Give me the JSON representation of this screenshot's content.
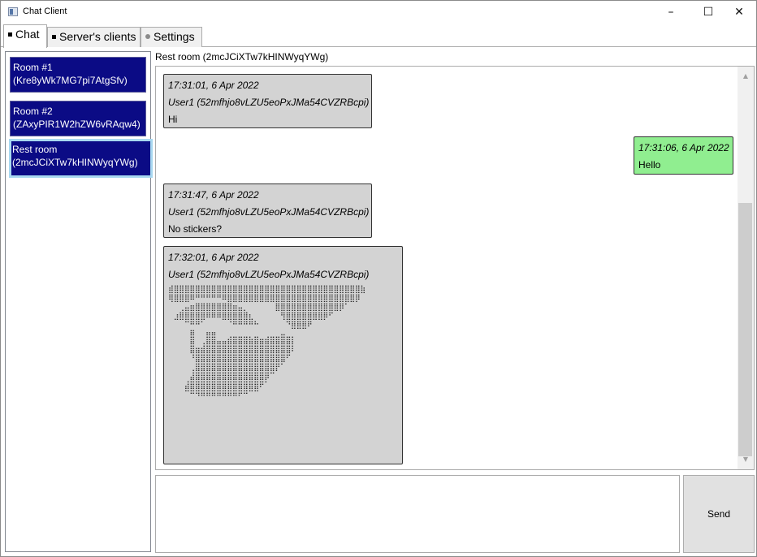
{
  "window": {
    "title": "Chat Client",
    "minimize": "–",
    "maximize": "☐",
    "close": "✕"
  },
  "tabs": [
    {
      "label": "Chat",
      "active": true
    },
    {
      "label": "Server's clients",
      "active": false
    },
    {
      "label": "Settings",
      "active": false
    }
  ],
  "rooms": [
    {
      "name": "Room #1",
      "id": "(Kre8yWk7MG7pi7AtgSfv)",
      "selected": false
    },
    {
      "name": "Room #2",
      "id": "(ZAxyPIR1W2hZW6vRAqw4)",
      "selected": false
    },
    {
      "name": "Rest room",
      "id": "(2mcJCiXTw7kHINWyqYWg)",
      "selected": true
    }
  ],
  "chat": {
    "header": "Rest room (2mcJCiXTw7kHINWyqYWg)",
    "messages": [
      {
        "time": "17:31:01, 6 Apr 2022",
        "user": "User1 (52mfhjo8vLZU5eoPxJMa54CVZRBcpi)",
        "text": "Hi",
        "mine": false
      },
      {
        "time": "17:31:06, 6 Apr 2022",
        "user": "",
        "text": "Hello",
        "mine": true
      },
      {
        "time": "17:31:47, 6 Apr 2022",
        "user": "User1 (52mfhjo8vLZU5eoPxJMa54CVZRBcpi)",
        "text": "No stickers?",
        "mine": false
      },
      {
        "time": "17:32:01, 6 Apr 2022",
        "user": "User1 (52mfhjo8vLZU5eoPxJMa54CVZRBcpi)",
        "text": "⣾⣿⣿⣿⣿⣿⣿⣿⣿⣿⣿⣿⣿⣿⣿⣿⣿⣿⣿⣿⣿⣿⣿⣿⣿⣿⣿⣿⣿⣿⣿⣿⣿⣿⣿⣿⣷\n⢿⣿⣿⣿⠿⠛⠛⠛⠛⠛⠿⣿⣿⣿⣿⣿⣿⣿⣿⣿⣿⣿⣿⣿⣿⣿⣿⣿⣿⣿⣿⣿⣿⣿⣿⡿\n⠀⠀⢀⣤⣶⣿⣿⣿⣿⣿⣿⣿⣶⣤⡀⠀⠀⠀⠀⠀⣿⣿⣿⣿⣿⣿⣿⣿⣿⣿⣿⣿⡿⠁\n⠀⣰⣿⣿⣿⣿⣿⠿⠿⠿⣿⣿⣿⣿⣿⣆⠀⠀⠀⠀⠀⢻⣿⣿⣿⣿⣿⣿⣿⡿⠋⠀\n⠀⠀⠀⠉⠛⠛⠁⠀⠀⠀⠀⠈⠛⠛⠛⠛⠓⠀⠀⠀⠀⠀⠙⣿⣿⣿⠟⠀⠀⠀\n⠀⠀⠀⠀⣿⠀⠀⣶⣶⠀⠀⢀⣀⣀⣀⡀⣀⠀⢀⣀⣀⣤⣀⡀⠀⠀⠀⠀\n⠀⠀⠀⠀⣿⠀⢠⣿⣿⣶⣶⣿⣿⣿⣿⣿⣿⣿⣿⣿⣿⣿⣿⡇⠀⠀⠀⠀\n⠀⠀⠀⠀⢿⣿⣿⣿⣿⣿⣿⣿⣿⣿⣿⣿⣿⣿⣿⣿⣿⣿⣿⠃⠀⠀⠀⠀\n⠀⠀⠀⠀⠈⣿⣿⣿⣿⣿⣿⣿⣿⣿⣿⣿⣿⣿⣿⣿⣿⡿⠁⠀⠀⠀⠀⠀\n⠀⠀⠀⠀⢠⣿⣿⣿⣿⣿⣿⣿⣿⣿⣿⣿⣿⣿⣿⣿⠏⠀⠀⠀⠀⠀⠀⠀\n⠀⠀⠀⢀⣾⣿⣿⣿⣿⣿⣿⣿⣿⣿⣿⣿⣿⣿⡟⠀⠀⠀⠀⠀⠀⠀⠀⠀\n⠀⠀⠀⣾⣿⣿⣿⣿⣿⣿⣿⣿⣿⣿⣿⣿⣿⠋⠀⠀⠀⠀⠀⠀⠀⠀⠀⠀\n⠀⠀⠀⠀⠉⠙⠛⠛⠛⠛⠛⠛⠛⠋⠉⠀⠀⠀⠀⠀⠀⠀⠀⠀⠀⠀⠀⠀",
        "mine": false,
        "sticker": true
      }
    ]
  },
  "input": {
    "value": "",
    "placeholder": ""
  },
  "send_label": "Send",
  "scroll": {
    "up": "▲",
    "down": "▼"
  }
}
